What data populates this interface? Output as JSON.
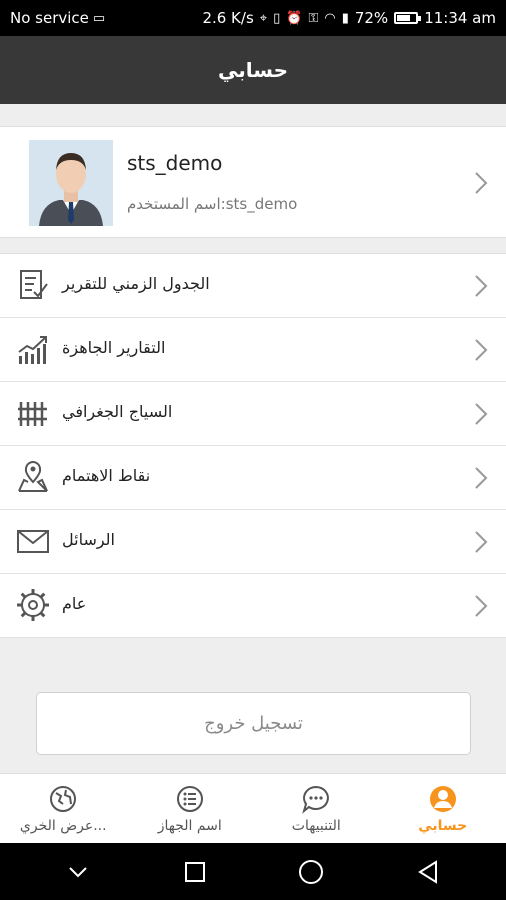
{
  "status_bar": {
    "carrier": "No service",
    "speed": "2.6 K/s",
    "battery": "72%",
    "battery_level": 0.72,
    "time": "11:34 am"
  },
  "header": {
    "title": "حسابي"
  },
  "profile": {
    "name": "sts_demo",
    "username_line": "اسم المستخدم:sts_demo"
  },
  "menu": {
    "items": [
      {
        "label": "الجدول الزمني للتقرير",
        "icon": "schedule-report-icon"
      },
      {
        "label": "التقارير الجاهزة",
        "icon": "chart-trend-icon"
      },
      {
        "label": "السياج الجغرافي",
        "icon": "fence-icon"
      },
      {
        "label": "نقاط الاهتمام",
        "icon": "poi-map-icon"
      },
      {
        "label": "الرسائل",
        "icon": "envelope-icon"
      },
      {
        "label": "عام",
        "icon": "gear-icon"
      }
    ]
  },
  "logout": {
    "label": "تسجيل خروج"
  },
  "tabs": [
    {
      "label": "عرض الخري...",
      "icon": "map-globe-icon",
      "active": false
    },
    {
      "label": "اسم الجهاز",
      "icon": "list-icon",
      "active": false
    },
    {
      "label": "التنبيهات",
      "icon": "chat-icon",
      "active": false
    },
    {
      "label": "حسابي",
      "icon": "user-icon",
      "active": true
    }
  ],
  "colors": {
    "accent": "#f7941d",
    "header_bg": "#383838"
  }
}
